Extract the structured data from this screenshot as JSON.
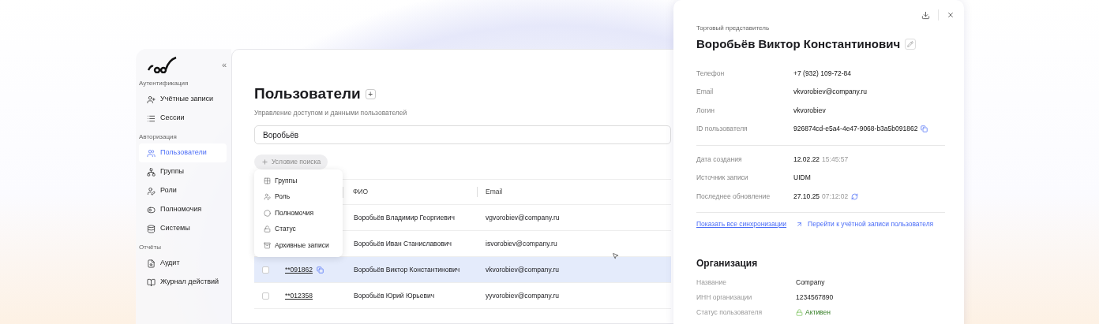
{
  "sidebar": {
    "collapse_label": "«",
    "sections": [
      {
        "title": "Аутентификация",
        "items": [
          {
            "label": "Учётные записи",
            "selected": false
          },
          {
            "label": "Сессии",
            "selected": false
          }
        ]
      },
      {
        "title": "Авторизация",
        "items": [
          {
            "label": "Пользователи",
            "selected": true
          },
          {
            "label": "Группы",
            "selected": false
          },
          {
            "label": "Роли",
            "selected": false
          },
          {
            "label": "Полномочия",
            "selected": false
          },
          {
            "label": "Системы",
            "selected": false
          }
        ]
      },
      {
        "title": "Отчёты",
        "items": [
          {
            "label": "Аудит",
            "selected": false
          },
          {
            "label": "Журнал действий",
            "selected": false
          }
        ]
      }
    ]
  },
  "page": {
    "title": "Пользователи",
    "add_label": "+",
    "subtitle": "Управление доступом и данными пользователей",
    "search": {
      "value": "Воробьёв"
    },
    "condition_button": "Условие поиска",
    "condition_menu": [
      {
        "label": "Группы"
      },
      {
        "label": "Роль"
      },
      {
        "label": "Полномочия"
      },
      {
        "label": "Статус"
      },
      {
        "label": "Архивные записи"
      }
    ]
  },
  "table": {
    "columns": [
      "ФИО",
      "Email"
    ],
    "rows": [
      {
        "id": "",
        "name": "Воробьёв Владимир Георгиевич",
        "email": "vgvorobiev@company.ru",
        "selected": false
      },
      {
        "id": "",
        "name": "Воробьёв Иван Станиславович",
        "email": "isvorobiev@company.ru",
        "selected": false
      },
      {
        "id": "**091862",
        "name": "Воробьёв Виктор Константинович",
        "email": "vkvorobiev@company.ru",
        "selected": true
      },
      {
        "id": "**012358",
        "name": "Воробьёв Юрий Юрьевич",
        "email": "yyvorobiev@company.ru",
        "selected": false
      }
    ]
  },
  "detail": {
    "role": "Торговый представитель",
    "name": "Воробьёв Виктор Константинович",
    "fields": [
      {
        "label": "Телефон",
        "value": "+7 (932) 109-72-84"
      },
      {
        "label": "Email",
        "value": "vkvorobiev@company.ru"
      },
      {
        "label": "Логин",
        "value": "vkvorobiev"
      },
      {
        "label": "ID пользователя",
        "value": "926874cd-e5a4-4e47-9068-b3a5b091862",
        "copy": true
      }
    ],
    "meta": [
      {
        "label": "Дата создания",
        "value": "12.02.22",
        "time": "15:45:57"
      },
      {
        "label": "Источник записи",
        "value": "UIDM"
      },
      {
        "label": "Последнее обновление",
        "value": "27.10.25",
        "time": "07:12:02",
        "refresh": true
      }
    ],
    "links": [
      "Показать все синхронизации",
      "Перейти к учётной записи пользователя"
    ],
    "organization": {
      "title": "Организация",
      "fields": [
        {
          "label": "Название",
          "value": "Company"
        },
        {
          "label": "ИНН организации",
          "value": "1234567890"
        },
        {
          "label": "Статус пользователя",
          "value": "Активен",
          "kind": "status"
        }
      ]
    }
  }
}
